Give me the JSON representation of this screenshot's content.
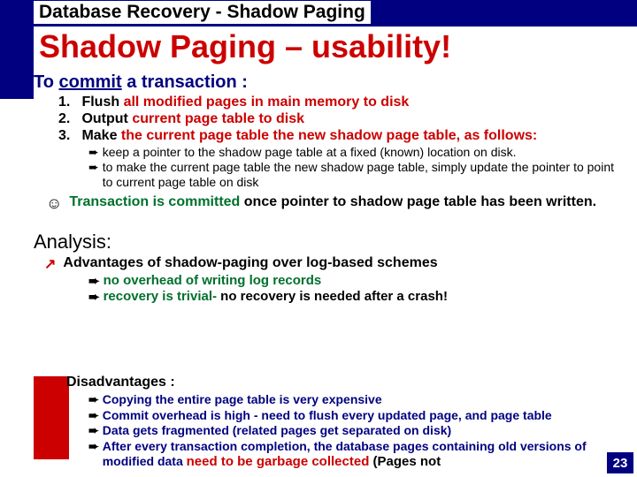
{
  "header": {
    "breadcrumb": "Database Recovery - Shadow Paging",
    "title": "Shadow Paging – usability!"
  },
  "commit": {
    "lead_prefix": "To ",
    "lead_underline": "commit",
    "lead_suffix": " a transaction :",
    "items": [
      {
        "num": "1.",
        "black": "Flush",
        "red": " all modified pages in main memory to disk"
      },
      {
        "num": "2.",
        "black": "Output",
        "red": " current page table to disk"
      },
      {
        "num": "3.",
        "black": "Make",
        "red": " the current page table the new shadow page table, as follows:"
      }
    ],
    "sub": [
      "keep a pointer to the shadow page table at a fixed (known) location on disk.",
      "to make the current page table the new shadow page table, simply update the pointer to point to current page table on disk"
    ],
    "done_prefix": "Transaction is committed",
    "done_suffix": " once pointer to shadow page table has been written."
  },
  "analysis": {
    "heading": "Analysis:",
    "advantages_label": "Advantages of shadow-paging over log-based schemes",
    "adv_items": [
      "no overhead of writing log records",
      {
        "pre": "recovery is trivial-",
        "post": " no recovery is needed after a crash!"
      }
    ],
    "disadvantages_label": "Disadvantages :",
    "dis_items": [
      "Copying the entire page table is very expensive",
      "Commit overhead is high - need to flush every updated page, and page table",
      "Data gets fragmented (related pages get separated on disk)",
      {
        "pre": "After every transaction completion, the database pages containing old versions of modified data ",
        "gc": "need to be garbage collected",
        "paren": "  (Pages not"
      }
    ]
  },
  "page_number": "23",
  "icons": {
    "arrow": "➨",
    "smile": "☺",
    "up": "↗",
    "down": "↘"
  }
}
